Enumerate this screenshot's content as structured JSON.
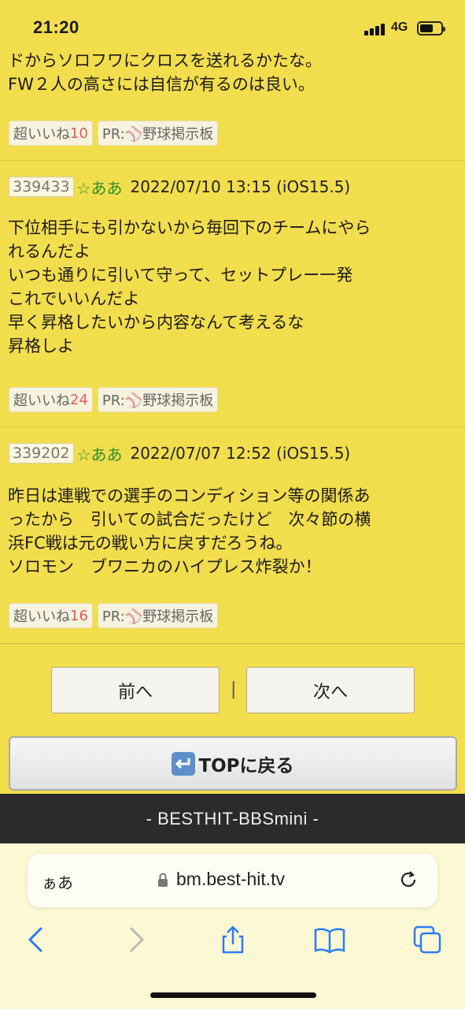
{
  "status": {
    "time": "21:20",
    "network": "4G"
  },
  "posts": [
    {
      "id": "",
      "name": "",
      "date": "",
      "body": "ドからソロフワにクロスを送れるかたな。\nFW２人の高さには自信が有るのは良い。",
      "likes_label": "超いいね",
      "likes_count": "10",
      "pr_label": "PR:⚾野球掲示板"
    },
    {
      "id": "339433",
      "name": "☆ああ",
      "date": "2022/07/10 13:15 (iOS15.5)",
      "body": "下位相手にも引かないから毎回下のチームにやら\nれるんだよ\nいつも通りに引いて守って、セットプレー一発\nこれでいいんだよ\n早く昇格したいから内容なんて考えるな\n昇格しよ",
      "likes_label": "超いいね",
      "likes_count": "24",
      "pr_label": "PR:⚾野球掲示板"
    },
    {
      "id": "339202",
      "name": "☆ああ",
      "date": "2022/07/07 12:52 (iOS15.5)",
      "body": "昨日は連戦での選手のコンディション等の関係あ\nったから　引いての試合だったけど　次々節の横\n浜FC戦は元の戦い方に戻すだろうね。\nソロモン　ブワニカのハイプレス炸裂か！",
      "likes_label": "超いいね",
      "likes_count": "16",
      "pr_label": "PR:⚾野球掲示板"
    }
  ],
  "pagination": {
    "prev": "前へ",
    "separator": "|",
    "next": "次へ"
  },
  "top_button": {
    "label": "TOPに戻る",
    "icon": "return-arrow-icon"
  },
  "footer": {
    "text": "- BESTHIT-BBSmini -"
  },
  "browser": {
    "aa_label": "ぁあ",
    "url": "bm.best-hit.tv",
    "icons": [
      "back-icon",
      "forward-icon",
      "share-icon",
      "bookmarks-icon",
      "tabs-icon"
    ]
  },
  "colors": {
    "background": "#f2dd4d",
    "name": "#2f8f2a",
    "like_count": "#e05c5c",
    "footer": "#2b2b2b"
  }
}
